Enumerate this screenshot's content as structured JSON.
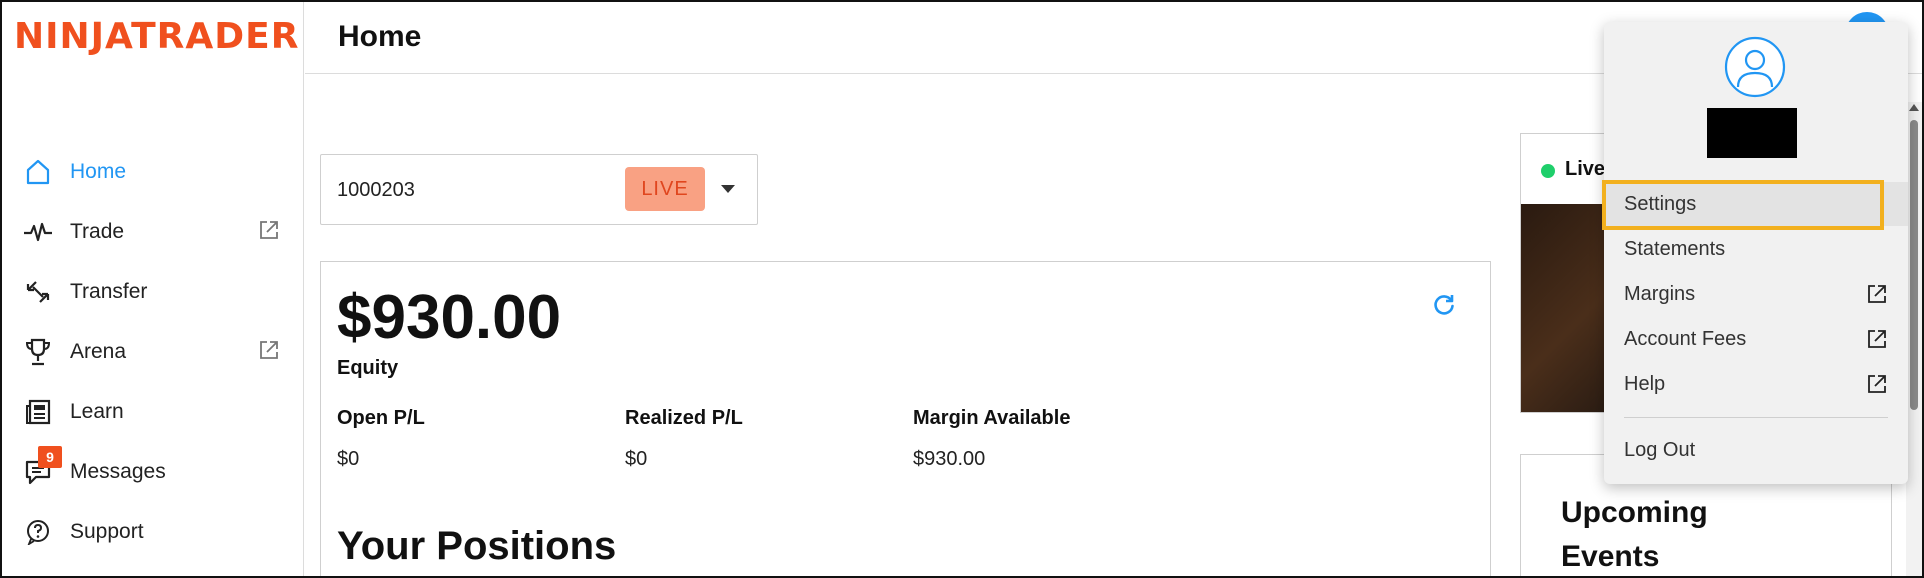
{
  "brand": {
    "logo_text": "NINJATRADER",
    "logo_color": "#f0501e"
  },
  "header": {
    "title": "Home"
  },
  "sidebar": {
    "items": [
      {
        "label": "Home",
        "icon": "home-icon",
        "active": true,
        "external": false
      },
      {
        "label": "Trade",
        "icon": "pulse-icon",
        "active": false,
        "external": true
      },
      {
        "label": "Transfer",
        "icon": "transfer-arrows-icon",
        "active": false,
        "external": false
      },
      {
        "label": "Arena",
        "icon": "trophy-icon",
        "active": false,
        "external": true
      },
      {
        "label": "Learn",
        "icon": "newspaper-icon",
        "active": false,
        "external": false
      },
      {
        "label": "Messages",
        "icon": "chat-icon",
        "active": false,
        "external": false,
        "badge": "9"
      },
      {
        "label": "Support",
        "icon": "help-circle-icon",
        "active": false,
        "external": false
      }
    ]
  },
  "account": {
    "number": "1000203",
    "status": "LIVE"
  },
  "equity": {
    "value": "$930.00",
    "label": "Equity",
    "stats": [
      {
        "label": "Open P/L",
        "value": "$0"
      },
      {
        "label": "Realized P/L",
        "value": "$0"
      },
      {
        "label": "Margin Available",
        "value": "$930.00"
      }
    ]
  },
  "positions": {
    "title": "Your Positions"
  },
  "live_card": {
    "label": "Live"
  },
  "events": {
    "title": "Upcoming Events"
  },
  "user_menu": {
    "items": [
      {
        "label": "Settings",
        "external": false,
        "selected": true
      },
      {
        "label": "Statements",
        "external": false
      },
      {
        "label": "Margins",
        "external": true
      },
      {
        "label": "Account Fees",
        "external": true
      },
      {
        "label": "Help",
        "external": true
      },
      {
        "label": "Log Out",
        "external": false
      }
    ]
  },
  "colors": {
    "accent": "#2196f3",
    "brand": "#f0501e",
    "live_badge_bg": "#f9a183",
    "highlight": "#f2b01e",
    "live_dot": "#1fcf6b"
  }
}
